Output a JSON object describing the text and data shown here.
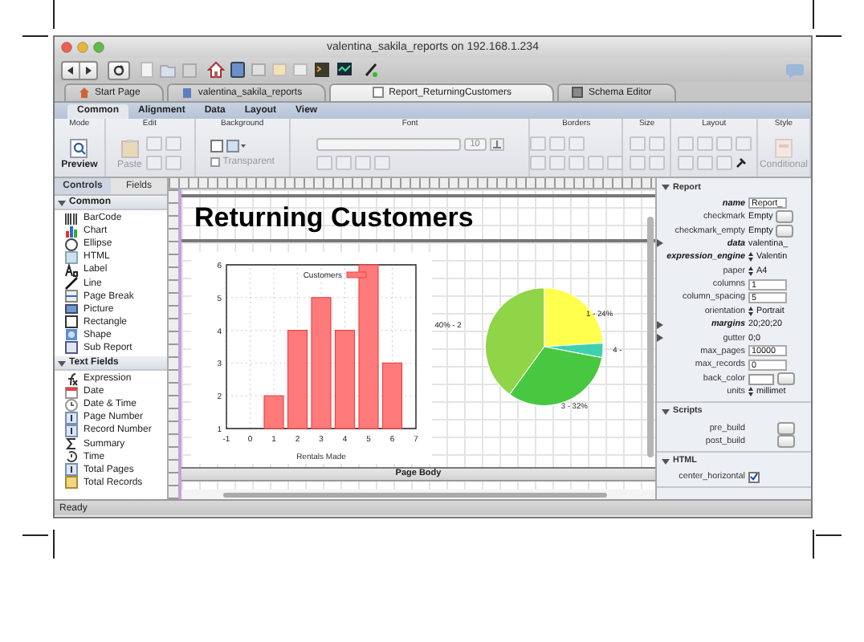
{
  "window": {
    "title": "valentina_sakila_reports on 192.168.1.234"
  },
  "doc_tabs": [
    {
      "label": "Start Page",
      "kind": "home",
      "selected": false
    },
    {
      "label": "valentina_sakila_reports",
      "kind": "database",
      "selected": false
    },
    {
      "label": "Report_ReturningCustomers",
      "kind": "report",
      "selected": true
    },
    {
      "label": "Schema Editor",
      "kind": "schema",
      "selected": false
    }
  ],
  "ribbon_tabs": [
    {
      "label": "Common",
      "selected": true
    },
    {
      "label": "Alignment",
      "selected": false
    },
    {
      "label": "Data",
      "selected": false
    },
    {
      "label": "Layout",
      "selected": false
    },
    {
      "label": "View",
      "selected": false
    }
  ],
  "ribbon_groups": [
    {
      "label": "Mode",
      "controls": [
        {
          "kind": "big",
          "label": "Preview",
          "disabled": false
        }
      ]
    },
    {
      "label": "Edit",
      "controls": [
        {
          "kind": "big",
          "label": "Paste",
          "disabled": true
        }
      ]
    },
    {
      "label": "Background",
      "controls": [
        {
          "kind": "checkbox",
          "label": "Transparent",
          "checked": false,
          "disabled": true
        }
      ]
    },
    {
      "label": "Font",
      "controls": [
        {
          "kind": "combo",
          "value": "10",
          "disabled": true
        }
      ]
    },
    {
      "label": "Borders"
    },
    {
      "label": "Size"
    },
    {
      "label": "Layout"
    },
    {
      "label": "Style",
      "controls": [
        {
          "kind": "big",
          "label": "Conditional",
          "disabled": true
        }
      ]
    }
  ],
  "left_panel": {
    "tabs": [
      {
        "label": "Controls",
        "selected": true
      },
      {
        "label": "Fields",
        "selected": false
      }
    ],
    "sections": [
      {
        "title": "Common",
        "expanded": true,
        "items": [
          {
            "label": "BarCode",
            "kind": "barcode"
          },
          {
            "label": "Chart",
            "kind": "chart"
          },
          {
            "label": "Ellipse",
            "kind": "ellipse"
          },
          {
            "label": "HTML",
            "kind": "html"
          },
          {
            "label": "Label",
            "kind": "label"
          },
          {
            "label": "Line",
            "kind": "line"
          },
          {
            "label": "Page Break",
            "kind": "pagebreak"
          },
          {
            "label": "Picture",
            "kind": "picture"
          },
          {
            "label": "Rectangle",
            "kind": "rectangle"
          },
          {
            "label": "Shape",
            "kind": "shape"
          },
          {
            "label": "Sub Report",
            "kind": "subreport"
          }
        ]
      },
      {
        "title": "Text Fields",
        "expanded": true,
        "items": [
          {
            "label": "Expression",
            "kind": "expression"
          },
          {
            "label": "Date",
            "kind": "date"
          },
          {
            "label": "Date & Time",
            "kind": "datetime"
          },
          {
            "label": "Page Number",
            "kind": "number"
          },
          {
            "label": "Record Number",
            "kind": "number"
          },
          {
            "label": "Summary",
            "kind": "summary"
          },
          {
            "label": "Time",
            "kind": "time"
          },
          {
            "label": "Total Pages",
            "kind": "number"
          },
          {
            "label": "Total Records",
            "kind": "records"
          }
        ]
      }
    ]
  },
  "report": {
    "title": "Returning Customers",
    "band": "Page Body",
    "bar_chart": {
      "chart_data": {
        "type": "bar",
        "xlabel": "Rentals Made",
        "x": [
          1,
          2,
          3,
          4,
          5,
          6
        ],
        "series": [
          {
            "name": "Customers",
            "color": "#ff7a7a",
            "values": [
              2,
              4,
              5,
              4,
              6,
              3
            ]
          }
        ],
        "xlim": [
          -1,
          7
        ],
        "ylim": [
          1,
          6
        ],
        "grid": true,
        "xticks": [
          -1,
          0,
          1,
          2,
          3,
          4,
          5,
          6,
          7
        ],
        "yticks": [
          1,
          2,
          3,
          4,
          5,
          6
        ]
      }
    },
    "pie_chart": {
      "chart_data": {
        "type": "pie",
        "series": [
          {
            "values": [
              24,
              4,
              32,
              40
            ]
          }
        ],
        "value_labels": [
          "1 - 24%",
          "4 -",
          "3 - 32%",
          "40% - 2"
        ]
      }
    }
  },
  "properties": [
    {
      "title": "Report",
      "expanded": true,
      "rows": [
        {
          "name": "name",
          "kind": "field",
          "value": "Report_",
          "modified": true
        },
        {
          "name": "checkmark",
          "kind": "text_button",
          "value": "Empty",
          "modified": false
        },
        {
          "name": "checkmark_empty",
          "kind": "text_button",
          "value": "Empty",
          "modified": false
        },
        {
          "name": "data",
          "kind": "expand",
          "value": "valentina_",
          "modified": true
        },
        {
          "name": "expression_engine",
          "kind": "popup",
          "value": "Valentin",
          "modified": true
        },
        {
          "name": "paper",
          "kind": "popup",
          "value": "A4",
          "modified": false
        },
        {
          "name": "columns",
          "kind": "field",
          "value": "1",
          "modified": false
        },
        {
          "name": "column_spacing",
          "kind": "field",
          "value": "5",
          "modified": false
        },
        {
          "name": "orientation",
          "kind": "popup",
          "value": "Portrait",
          "modified": false
        },
        {
          "name": "margins",
          "kind": "expand",
          "value": "20;20;20",
          "modified": true
        },
        {
          "name": "gutter",
          "kind": "expand",
          "value": "0;0",
          "modified": false
        },
        {
          "name": "max_pages",
          "kind": "field",
          "value": "10000",
          "modified": false
        },
        {
          "name": "max_records",
          "kind": "field",
          "value": "0",
          "modified": false
        },
        {
          "name": "back_color",
          "kind": "color",
          "modified": false
        },
        {
          "name": "units",
          "kind": "popup",
          "value": "millimet",
          "modified": false
        }
      ]
    },
    {
      "title": "Scripts",
      "expanded": true,
      "rows": [
        {
          "name": "pre_build",
          "kind": "button",
          "modified": false
        },
        {
          "name": "post_build",
          "kind": "button",
          "modified": false
        }
      ]
    },
    {
      "title": "HTML",
      "expanded": true,
      "rows": [
        {
          "name": "center_horizontal",
          "kind": "checkbox",
          "checked": true,
          "modified": false
        }
      ]
    }
  ],
  "status_bar": {
    "text": "Ready"
  }
}
